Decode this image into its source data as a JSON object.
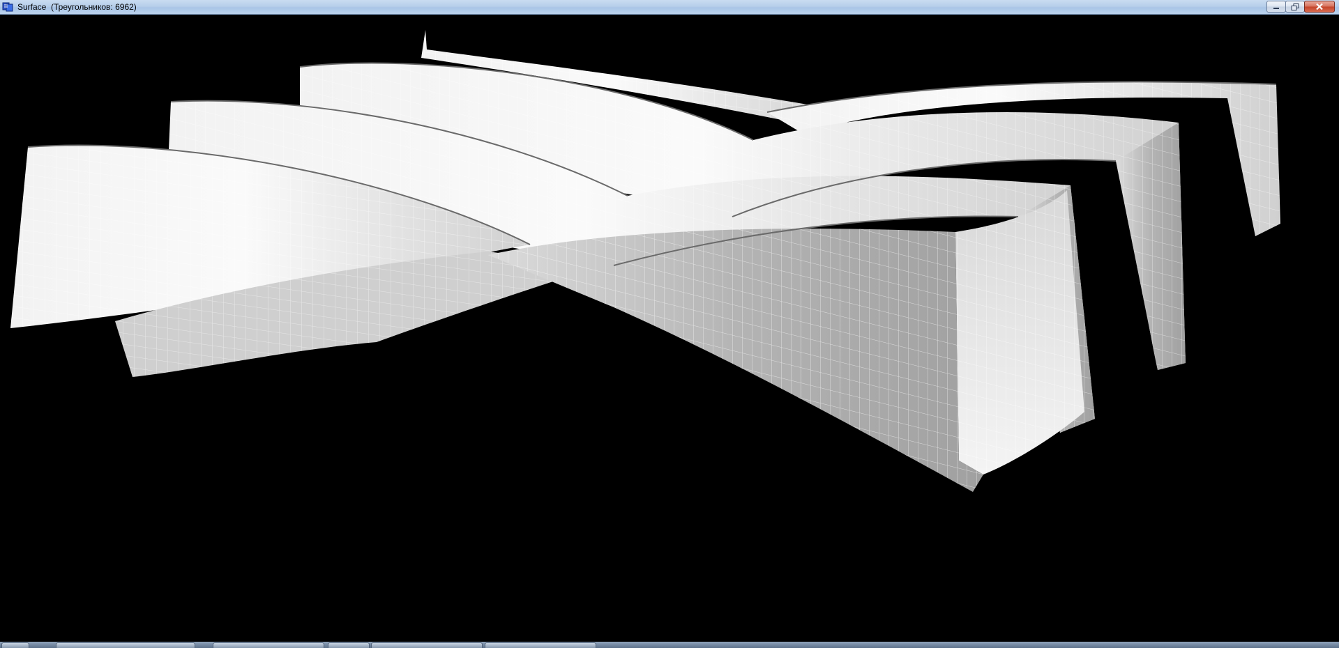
{
  "window": {
    "title": "Surface  (Треугольников: 6962)",
    "icon": "app-icon",
    "controls": {
      "minimize": "minimize-icon",
      "maximize": "restore-icon",
      "close": "close-icon"
    }
  },
  "viewport": {
    "background": "#000000",
    "surface_color": "#e8e8e8",
    "wire_color": "#ffffff",
    "shade_color": "#9a9a9a"
  },
  "taskbar": {
    "color": "#6f839c"
  }
}
